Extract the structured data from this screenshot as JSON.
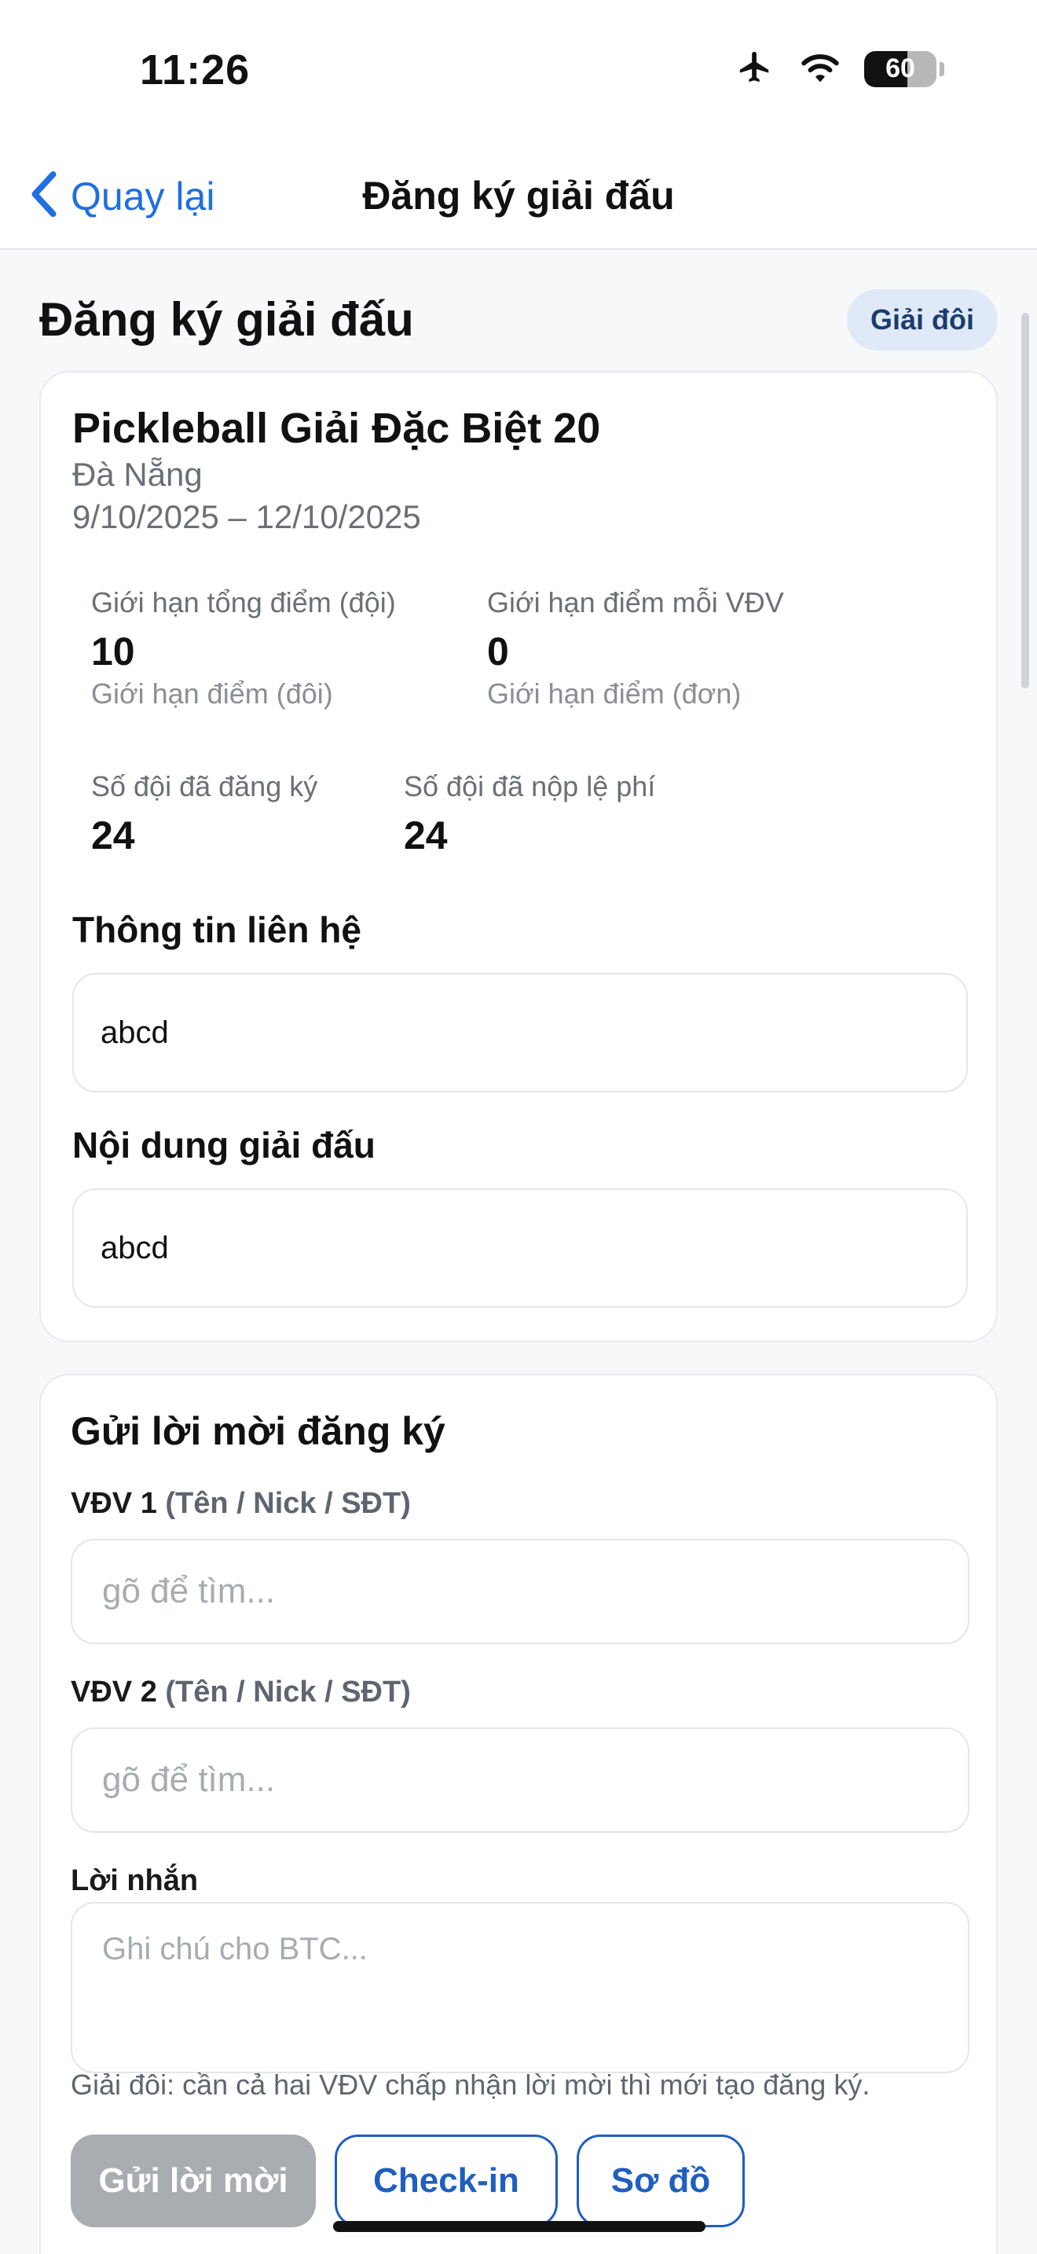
{
  "status_bar": {
    "time": "11:26",
    "battery_level": "60"
  },
  "nav": {
    "back_label": "Quay lại",
    "title": "Đăng ký giải đấu"
  },
  "page": {
    "heading": "Đăng ký giải đấu",
    "mode_badge": "Giải đôi"
  },
  "tournament": {
    "title": "Pickleball Giải Đặc Biệt 20",
    "location": "Đà Nẵng",
    "dates": "9/10/2025 – 12/10/2025",
    "stats": {
      "team_limit_label": "Giới hạn tổng điểm (đội)",
      "team_limit_value": "10",
      "team_limit_sub": "Giới hạn điểm (đôi)",
      "player_limit_label": "Giới hạn điểm mỗi VĐV",
      "player_limit_value": "0",
      "player_limit_sub": "Giới hạn điểm (đơn)",
      "registered_label": "Số đội đã đăng ký",
      "registered_value": "24",
      "paid_label": "Số đội đã nộp lệ phí",
      "paid_value": "24"
    },
    "contact_label": "Thông tin liên hệ",
    "contact_value": "abcd",
    "content_label": "Nội dung giải đấu",
    "content_value": "abcd"
  },
  "invite": {
    "title": "Gửi lời mời đăng ký",
    "player1_label": "VĐV 1",
    "player2_label": "VĐV 2",
    "player_hint": "(Tên / Nick / SĐT)",
    "search_placeholder": "gõ để tìm...",
    "message_label": "Lời nhắn",
    "message_placeholder": "Ghi chú cho BTC...",
    "note": "Giải đôi: cần cả hai VĐV chấp nhận lời mời thì mới tạo đăng ký.",
    "send_button": "Gửi lời mời",
    "checkin_button": "Check-in",
    "chart_button": "Sơ đồ"
  },
  "colors": {
    "accent": "#1f5fbf",
    "link": "#1f6fe0",
    "badge_bg": "#dfe9f7",
    "disabled": "#a9acb1"
  },
  "icons": {
    "back": "chevron-left-icon",
    "airplane": "airplane-icon",
    "wifi": "wifi-icon",
    "battery": "battery-icon"
  }
}
